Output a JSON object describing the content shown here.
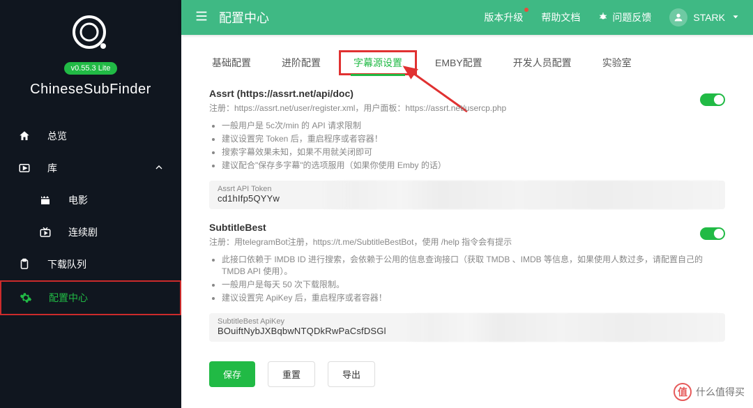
{
  "sidebar": {
    "version": "v0.55.3 Lite",
    "app_name": "ChineseSubFinder",
    "items": [
      {
        "label": "总览"
      },
      {
        "label": "库"
      },
      {
        "label": "电影"
      },
      {
        "label": "连续剧"
      },
      {
        "label": "下载队列"
      },
      {
        "label": "配置中心"
      }
    ]
  },
  "topbar": {
    "title": "配置中心",
    "links": {
      "upgrade": "版本升级",
      "help": "帮助文档",
      "feedback": "问题反馈"
    },
    "user_name": "STARK"
  },
  "tabs": [
    "基础配置",
    "进阶配置",
    "字幕源设置",
    "EMBY配置",
    "开发人员配置",
    "实验室"
  ],
  "sections": {
    "assrt": {
      "title": "Assrt  (https://assrt.net/api/doc)",
      "sub": "注册：https://assrt.net/user/register.xml，用户面板：https://assrt.net/usercp.php",
      "notes": [
        "一般用户是 5c次/min 的 API 请求限制",
        "建议设置完 Token 后，重启程序或者容器！",
        "搜索字幕效果未知，如果不用就关闭即可",
        "建议配合\"保存多字幕\"的选项服用（如果你使用 Emby 的话）"
      ],
      "field_label": "Assrt API Token",
      "field_value": "cd1hIfp5QYYw"
    },
    "subtitlebest": {
      "title": "SubtitleBest",
      "sub": "注册：用telegramBot注册，https://t.me/SubtitleBestBot，使用 /help 指令会有提示",
      "notes": [
        "此接口依赖于 IMDB ID 进行搜索，会依赖于公用的信息查询接口（获取 TMDB 、IMDB 等信息，如果使用人数过多，请配置自己的 TMDB API 使用）。",
        "一般用户是每天 50 次下载限制。",
        "建议设置完 ApiKey 后，重启程序或者容器！"
      ],
      "field_label": "SubtitleBest ApiKey",
      "field_value": "BOuiftNybJXBqbwNTQDkRwPaCsfDSGl"
    }
  },
  "actions": {
    "save": "保存",
    "reset": "重置",
    "export": "导出"
  },
  "watermark": "什么值得买"
}
